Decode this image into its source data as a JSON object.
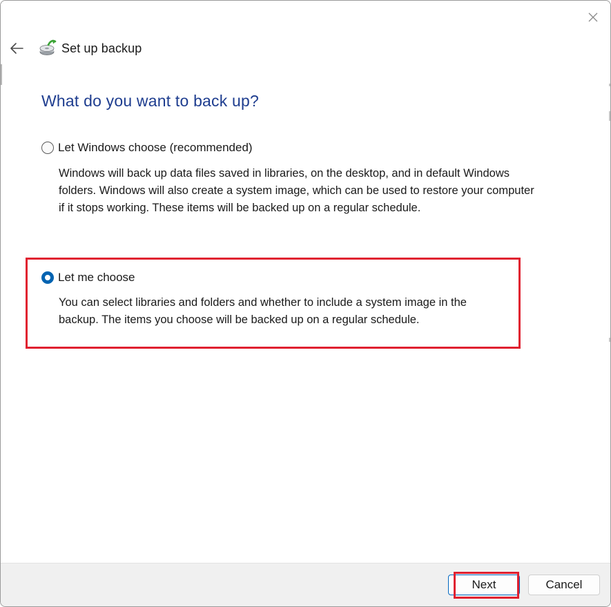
{
  "window": {
    "title": "Set up backup",
    "icons": {
      "close": "close-icon",
      "back": "back-arrow-icon",
      "app": "backup-drive-icon"
    }
  },
  "main": {
    "heading": "What do you want to back up?",
    "options": [
      {
        "label": "Let Windows choose (recommended)",
        "selected": false,
        "description_lines": [
          "Windows will back up data files saved in libraries, on the desktop, and in default Windows",
          "folders. Windows will also create a system image, which can be used to restore your computer",
          "if it stops working. These items will be backed up on a regular schedule."
        ]
      },
      {
        "label": "Let me choose",
        "selected": true,
        "description_lines": [
          "You can select libraries and folders and whether to include a system image in the",
          "backup. The items you choose will be backed up on a regular schedule."
        ]
      }
    ]
  },
  "footer": {
    "next_label": "Next",
    "cancel_label": "Cancel"
  },
  "colors": {
    "heading": "#1e3d8f",
    "accent": "#0063b1",
    "highlight": "#e02030"
  }
}
